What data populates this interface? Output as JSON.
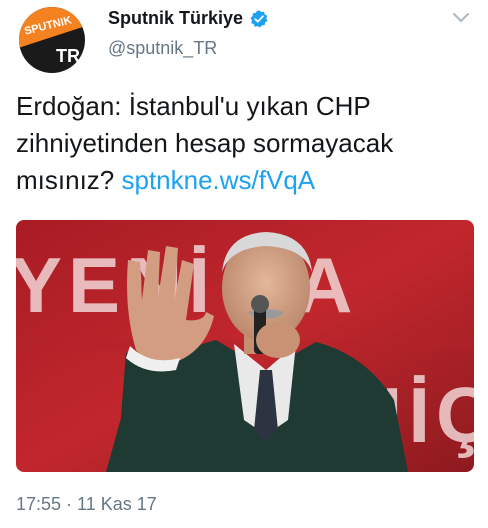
{
  "account": {
    "display_name": "Sputnik Türkiye",
    "handle": "@sputnik_TR",
    "avatar_logo_text": "SPUTNIK",
    "avatar_logo_badge": "TR",
    "verified_icon": "verified-badge-icon",
    "menu_icon": "chevron-down-icon"
  },
  "tweet": {
    "text": "Erdoğan: İstanbul'u yıkan CHP zihniyetinden hesap sormayacak mısınız?",
    "link": "sptnkne.ws/fVqA"
  },
  "media": {
    "background_text_top": "YENİ PA",
    "background_text_bottom": "NİÇİ"
  },
  "meta": {
    "timestamp": "17:55 · 11 Kas 17"
  },
  "colors": {
    "link": "#1da1f2",
    "secondary_text": "#657786",
    "verified": "#1da1f2",
    "brand_orange": "#f58220"
  }
}
